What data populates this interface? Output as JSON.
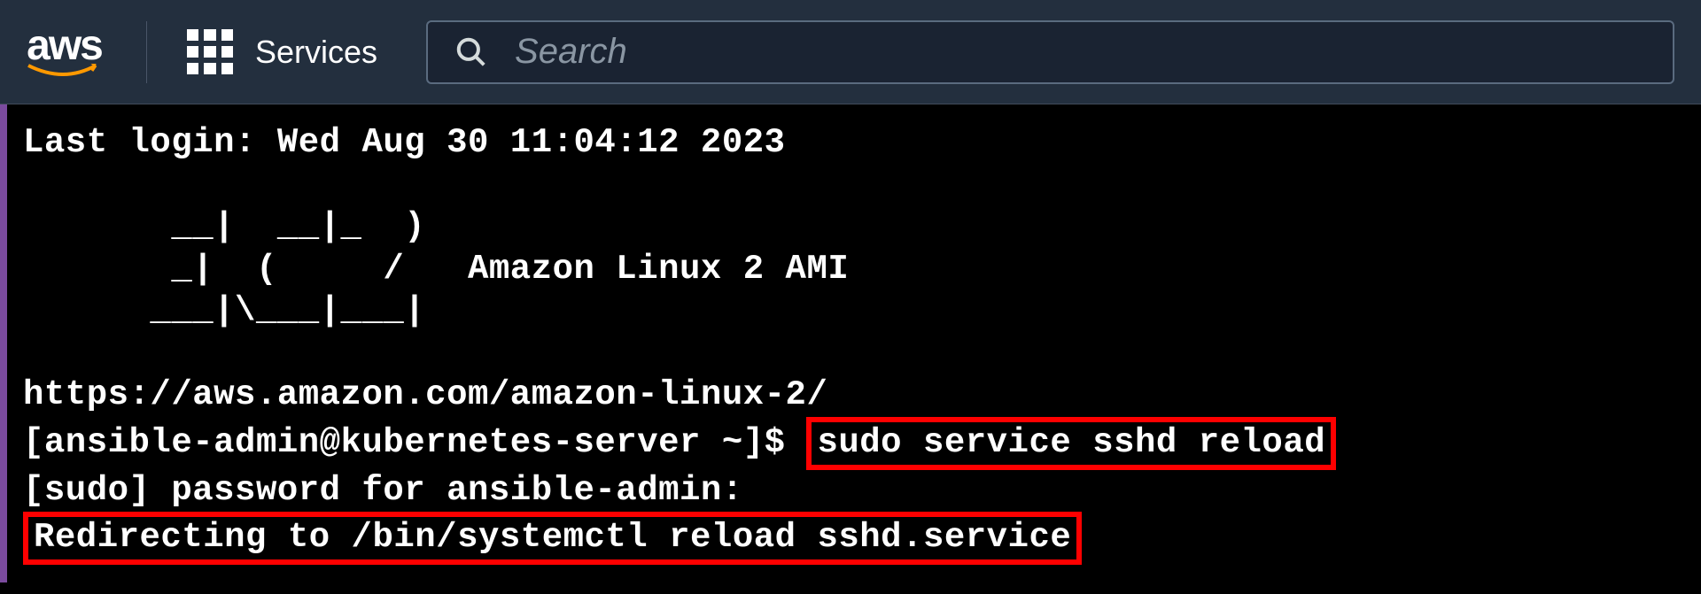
{
  "header": {
    "logo_text": "aws",
    "services_label": "Services",
    "search_placeholder": "Search"
  },
  "terminal": {
    "last_login": "Last login: Wed Aug 30 11:04:12 2023",
    "banner_line1": "       __|  __|_  )",
    "banner_line2": "       _|  (     /   Amazon Linux 2 AMI",
    "banner_line3": "      ___|\\___|___|",
    "url": "https://aws.amazon.com/amazon-linux-2/",
    "prompt": "[ansible-admin@kubernetes-server ~]$ ",
    "command": "sudo service sshd reload",
    "sudo_prompt": "[sudo] password for ansible-admin:",
    "output": "Redirecting to /bin/systemctl reload sshd.service"
  }
}
